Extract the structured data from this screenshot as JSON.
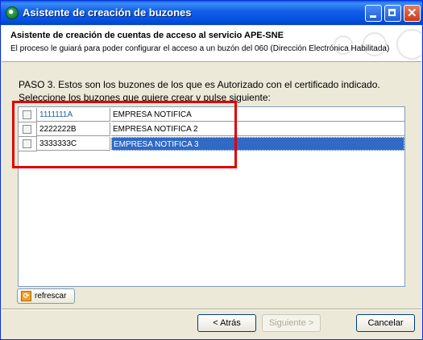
{
  "window": {
    "title": "Asistente de creación de buzones"
  },
  "header": {
    "title": "Asistente de creación de cuentas de acceso al servicio APE-SNE",
    "subtitle": "El proceso le guiará para poder configurar el acceso a un buzón del 060 (Dirección Electrónica Habilitada)"
  },
  "content": {
    "step_text": "PASO 3.  Estos son los buzones de los que es Autorizado con el certificado indicado.",
    "instruction": "Seleccione los buzones que quiere crear y pulse siguiente:"
  },
  "mailboxes": [
    {
      "id": "1111111A",
      "name": "EMPRESA NOTIFICA",
      "checked": false
    },
    {
      "id": "2222222B",
      "name": "EMPRESA NOTIFICA 2",
      "checked": false
    },
    {
      "id": "3333333C",
      "name": "EMPRESA NOTIFICA 3",
      "checked": false,
      "selected": true
    }
  ],
  "refresh_button": {
    "label": "refrescar"
  },
  "buttons": {
    "back": "< Atrás",
    "next": "Siguiente >",
    "cancel": "Cancelar"
  },
  "colors": {
    "titlebar": "#0a5de0",
    "selection": "#316ac5",
    "highlight_box": "#e00000"
  }
}
